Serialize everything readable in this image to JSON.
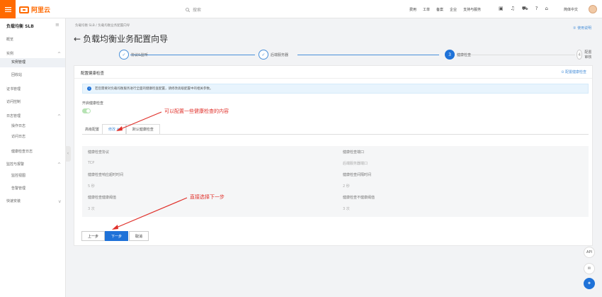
{
  "topbar": {
    "logo_text": "阿里云",
    "search_placeholder": "搜索",
    "nav": [
      "费用",
      "工单",
      "备案",
      "企业",
      "支持与服务"
    ],
    "lang": "简体中文"
  },
  "sidebar": {
    "title": "负载均衡 SLB",
    "items": [
      {
        "label": "概览",
        "sub": false
      },
      {
        "label": "实例",
        "sub": false,
        "arrow": "^"
      },
      {
        "label": "实例管理",
        "sub": true,
        "active": true
      },
      {
        "label": "回收站",
        "sub": true
      },
      {
        "label": "证书管理",
        "sub": false
      },
      {
        "label": "访问控制",
        "sub": false
      },
      {
        "label": "日志管理",
        "sub": false,
        "arrow": "^"
      },
      {
        "label": "操作日志",
        "sub": true
      },
      {
        "label": "访问日志",
        "sub": true
      },
      {
        "label": "健康检查日志",
        "sub": true
      },
      {
        "label": "监控与报警",
        "sub": false,
        "arrow": "^"
      },
      {
        "label": "监控视图",
        "sub": true
      },
      {
        "label": "告警管理",
        "sub": true
      },
      {
        "label": "快速安装",
        "sub": false,
        "arrow": "v"
      }
    ]
  },
  "header": {
    "breadcrumb": "负载均衡 SLB / 负载均衡业务配置向导",
    "help": "② 使用说明",
    "title": "负载均衡业务配置向导",
    "back": "←"
  },
  "steps": [
    {
      "num": "✓",
      "label": "协议&监听",
      "state": "done"
    },
    {
      "num": "✓",
      "label": "后端服务器",
      "state": "done"
    },
    {
      "num": "3",
      "label": "健康检查",
      "state": "active"
    },
    {
      "num": "4",
      "label": "配置审核",
      "state": "pending"
    }
  ],
  "card": {
    "title": "配置健康检查",
    "link": "⊙ 配置健康检查",
    "info": "若您需要对负载均衡服务进行全面的健康检查配置，请修改高级配置中的相关参数。",
    "hc_label": "开启健康检查",
    "tab_prefix": "高级配置",
    "tabs": [
      "修改 ⊗",
      "默认健康检查"
    ],
    "fields": [
      {
        "k": "健康检查协议",
        "v": "TCP"
      },
      {
        "k": "健康检查端口",
        "v": "后端服务器端口"
      },
      {
        "k": "健康检查响应超时时间",
        "v": "5 秒"
      },
      {
        "k": "健康检查间隔时间",
        "v": "2 秒"
      },
      {
        "k": "健康检查健康阈值",
        "v": "3 次"
      },
      {
        "k": "健康检查不健康阈值",
        "v": "3 次"
      }
    ],
    "buttons": {
      "prev": "上一步",
      "next": "下一步",
      "cancel": "取消"
    }
  },
  "annotations": {
    "top": "可以配置一些健康检查的内容",
    "bottom": "直接选择下一步"
  },
  "floats": {
    "api": "API"
  },
  "colors": {
    "brand": "#ff6a00",
    "primary": "#1f72d8",
    "annot": "#e0302a"
  }
}
